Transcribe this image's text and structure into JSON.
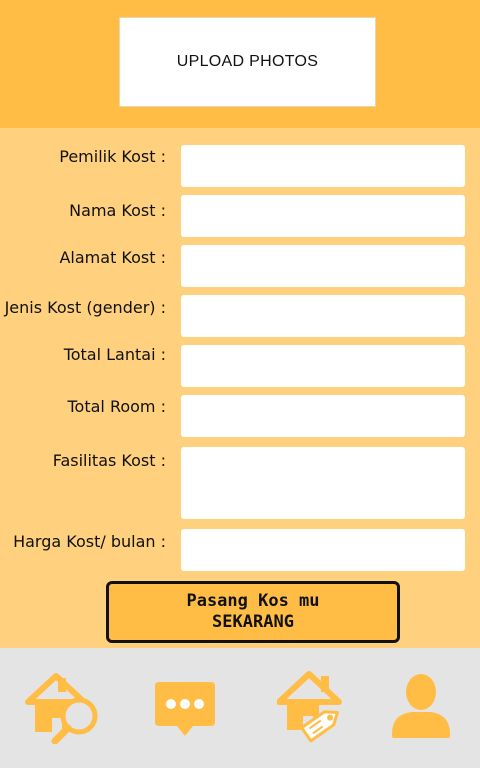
{
  "header": {
    "upload_label": "UPLOAD PHOTOS"
  },
  "form": {
    "fields": [
      {
        "label": "Pemilik Kost :",
        "value": ""
      },
      {
        "label": "Nama Kost :",
        "value": ""
      },
      {
        "label": "Alamat Kost :",
        "value": ""
      },
      {
        "label": "Jenis Kost (gender) :",
        "value": ""
      },
      {
        "label": "Total Lantai :",
        "value": ""
      },
      {
        "label": "Total Room :",
        "value": ""
      },
      {
        "label": "Fasilitas Kost :",
        "value": ""
      },
      {
        "label": "Harga Kost/ bulan :",
        "value": ""
      }
    ]
  },
  "submit": {
    "line1": "Pasang Kos mu",
    "line2": "SEKARANG"
  },
  "nav": {
    "items": [
      {
        "icon": "home-search-icon"
      },
      {
        "icon": "chat-icon"
      },
      {
        "icon": "home-tag-icon"
      },
      {
        "icon": "user-icon"
      }
    ]
  },
  "colors": {
    "accent": "#FFBD45",
    "background": "#FFD07E",
    "nav_bg": "#E4E4E4"
  }
}
